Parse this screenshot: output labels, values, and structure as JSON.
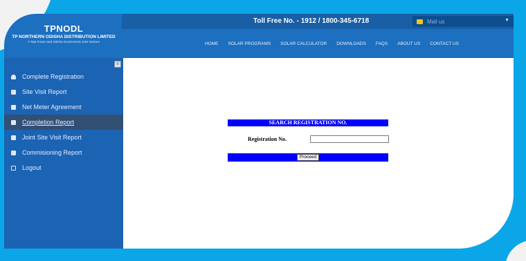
{
  "header": {
    "toll_free": "Toll Free No. - 1912 / 1800-345-6718",
    "mail": "Mail us",
    "logo_main": "TPNODL",
    "logo_sub": "TP NORTHERN ODISHA DISTRIBUTION LIMITED",
    "logo_tag": "A Tata Power and Odisha Government Joint Venture",
    "nav": [
      "HOME",
      "SOLAR PROGRAMS",
      "SOLAR CALCULATOR",
      "DOWNLOADS",
      "FAQS",
      "ABOUT US",
      "CONTACT US"
    ]
  },
  "sidebar": {
    "items": [
      {
        "label": "Complete Registration",
        "icon": "user-icon"
      },
      {
        "label": "Site Visit Report",
        "icon": "document-icon"
      },
      {
        "label": "Net Meter Agreement",
        "icon": "agreement-icon"
      },
      {
        "label": "Completion Report",
        "icon": "report-icon",
        "active": true
      },
      {
        "label": "Joint Site Visit Report",
        "icon": "document-icon"
      },
      {
        "label": "Commisioning Report",
        "icon": "document-icon"
      },
      {
        "label": "Logout",
        "icon": "logout-icon"
      }
    ]
  },
  "main": {
    "search_title": "SEARCH REGISTRATION NO.",
    "reg_label": "Registration No.",
    "reg_value": "",
    "proceed": "Proceed"
  }
}
